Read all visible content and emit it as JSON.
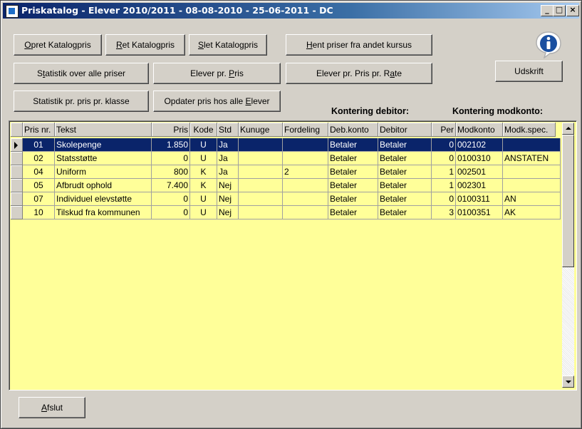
{
  "window": {
    "title": "Priskatalog - Elever 2010/2011 - 08-08-2010 - 25-06-2011 - DC",
    "minimize": "_",
    "maximize": "□",
    "close": "×"
  },
  "toolbar": {
    "opret": {
      "u": "O",
      "rest": "pret Katalogpris"
    },
    "ret": {
      "u": "R",
      "rest": "et Katalogpris"
    },
    "slet": {
      "u": "S",
      "rest": "let Katalogpris"
    },
    "hent": {
      "u": "H",
      "rest": "ent priser fra andet kursus"
    },
    "statistik_alle": {
      "pre": "S",
      "u": "t",
      "rest": "atistik over alle priser"
    },
    "elever_pris": {
      "pre": "Elever pr. ",
      "u": "P",
      "rest": "ris"
    },
    "elever_rate": {
      "pre": "Elever pr. Pris pr. R",
      "u": "a",
      "rest": "te"
    },
    "udskrift": "Udskrift",
    "statistik_klasse": "Statistik pr. pris pr. klasse",
    "opdater": {
      "pre": "Opdater pris hos alle ",
      "u": "E",
      "rest": "lever"
    },
    "afslut": {
      "u": "A",
      "rest": "fslut"
    }
  },
  "labels": {
    "debitor": "Kontering debitor:",
    "modkonto": "Kontering modkonto:"
  },
  "icons": {
    "info": "info-icon"
  },
  "table": {
    "columns": [
      "Pris nr.",
      "Tekst",
      "Pris",
      "Kode",
      "Std",
      "Kunuge",
      "Fordeling",
      "Deb.konto",
      "Debitor",
      "Per",
      "Modkonto",
      "Modk.spec."
    ],
    "rows": [
      [
        "01",
        "Skolepenge",
        "1.850",
        "U",
        "Ja",
        "",
        "",
        "Betaler",
        "Betaler",
        "0",
        "002102",
        ""
      ],
      [
        "02",
        "Statsstøtte",
        "0",
        "U",
        "Ja",
        "",
        "",
        "Betaler",
        "Betaler",
        "0",
        "0100310",
        "ANSTATEN"
      ],
      [
        "04",
        "Uniform",
        "800",
        "K",
        "Ja",
        "",
        "2",
        "Betaler",
        "Betaler",
        "1",
        "002501",
        ""
      ],
      [
        "05",
        "Afbrudt ophold",
        "7.400",
        "K",
        "Nej",
        "",
        "",
        "Betaler",
        "Betaler",
        "1",
        "002301",
        ""
      ],
      [
        "07",
        "Individuel elevstøtte",
        "0",
        "U",
        "Nej",
        "",
        "",
        "Betaler",
        "Betaler",
        "0",
        "0100311",
        "AN"
      ],
      [
        "10",
        "Tilskud fra kommunen",
        "0",
        "U",
        "Nej",
        "",
        "",
        "Betaler",
        "Betaler",
        "3",
        "0100351",
        "AK"
      ]
    ],
    "selected_row": 0
  }
}
